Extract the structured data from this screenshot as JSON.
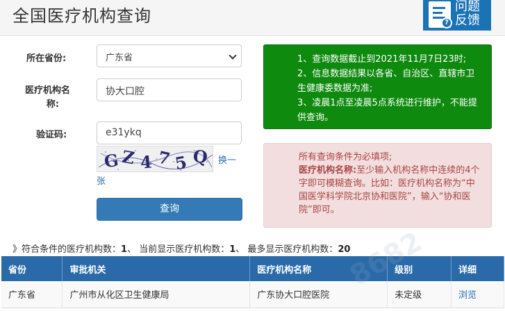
{
  "header": {
    "title": "全国医疗机构查询",
    "feedback_line1": "问题",
    "feedback_line2": "反馈",
    "feedback_q": "?"
  },
  "form": {
    "province_label": "所在省份:",
    "province_value": "广东省",
    "org_label_1": "医疗机构名",
    "org_label_2": "称:",
    "org_value": "协大口腔",
    "captcha_label": "验证码:",
    "captcha_value": "e31ykq",
    "captcha_chars": [
      "G",
      "Z",
      "4",
      "7",
      "5",
      "Q"
    ],
    "refresh_1": "换一",
    "refresh_2": "张",
    "query_button": "查询"
  },
  "notice_green": {
    "line1": "1、查询数据截止到2021年11月7日23时;",
    "line2": "2、信息数据结果以各省、自治区、直辖市卫生健康委数据为准;",
    "line3": "3、凌晨1点至凌晨5点系统进行维护，不能提供查询。"
  },
  "notice_red": {
    "line1": "所有查询条件为必填项;",
    "line2_bold": "医疗机构名称:",
    "line2_rest": "至少输入机构名称中连续的4个字即可模糊查询。比如：医疗机构名称为“中国医学科学院北京协和医院”，输入“协和医院”即可。"
  },
  "summary": {
    "prefix": "》符合条件的医疗机构数：",
    "matched": "1",
    "mid1": "、 当前显示医疗机构数：",
    "shown": "1",
    "mid2": "、 最多显示医疗机构数：",
    "max": "20"
  },
  "table": {
    "headers": [
      "省份",
      "审批机关",
      "医疗机构名称",
      "级别",
      "详细"
    ],
    "rows": [
      [
        "广东省",
        "广州市从化区卫生健康局",
        "广东协大口腔医院",
        "未定级",
        "浏览"
      ]
    ]
  },
  "watermark": "8682",
  "colors": {
    "header_blue": "#2a6aa8",
    "notice_green": "#0e8a0e",
    "notice_red_bg": "#f2dede",
    "button_blue": "#337ab7"
  }
}
